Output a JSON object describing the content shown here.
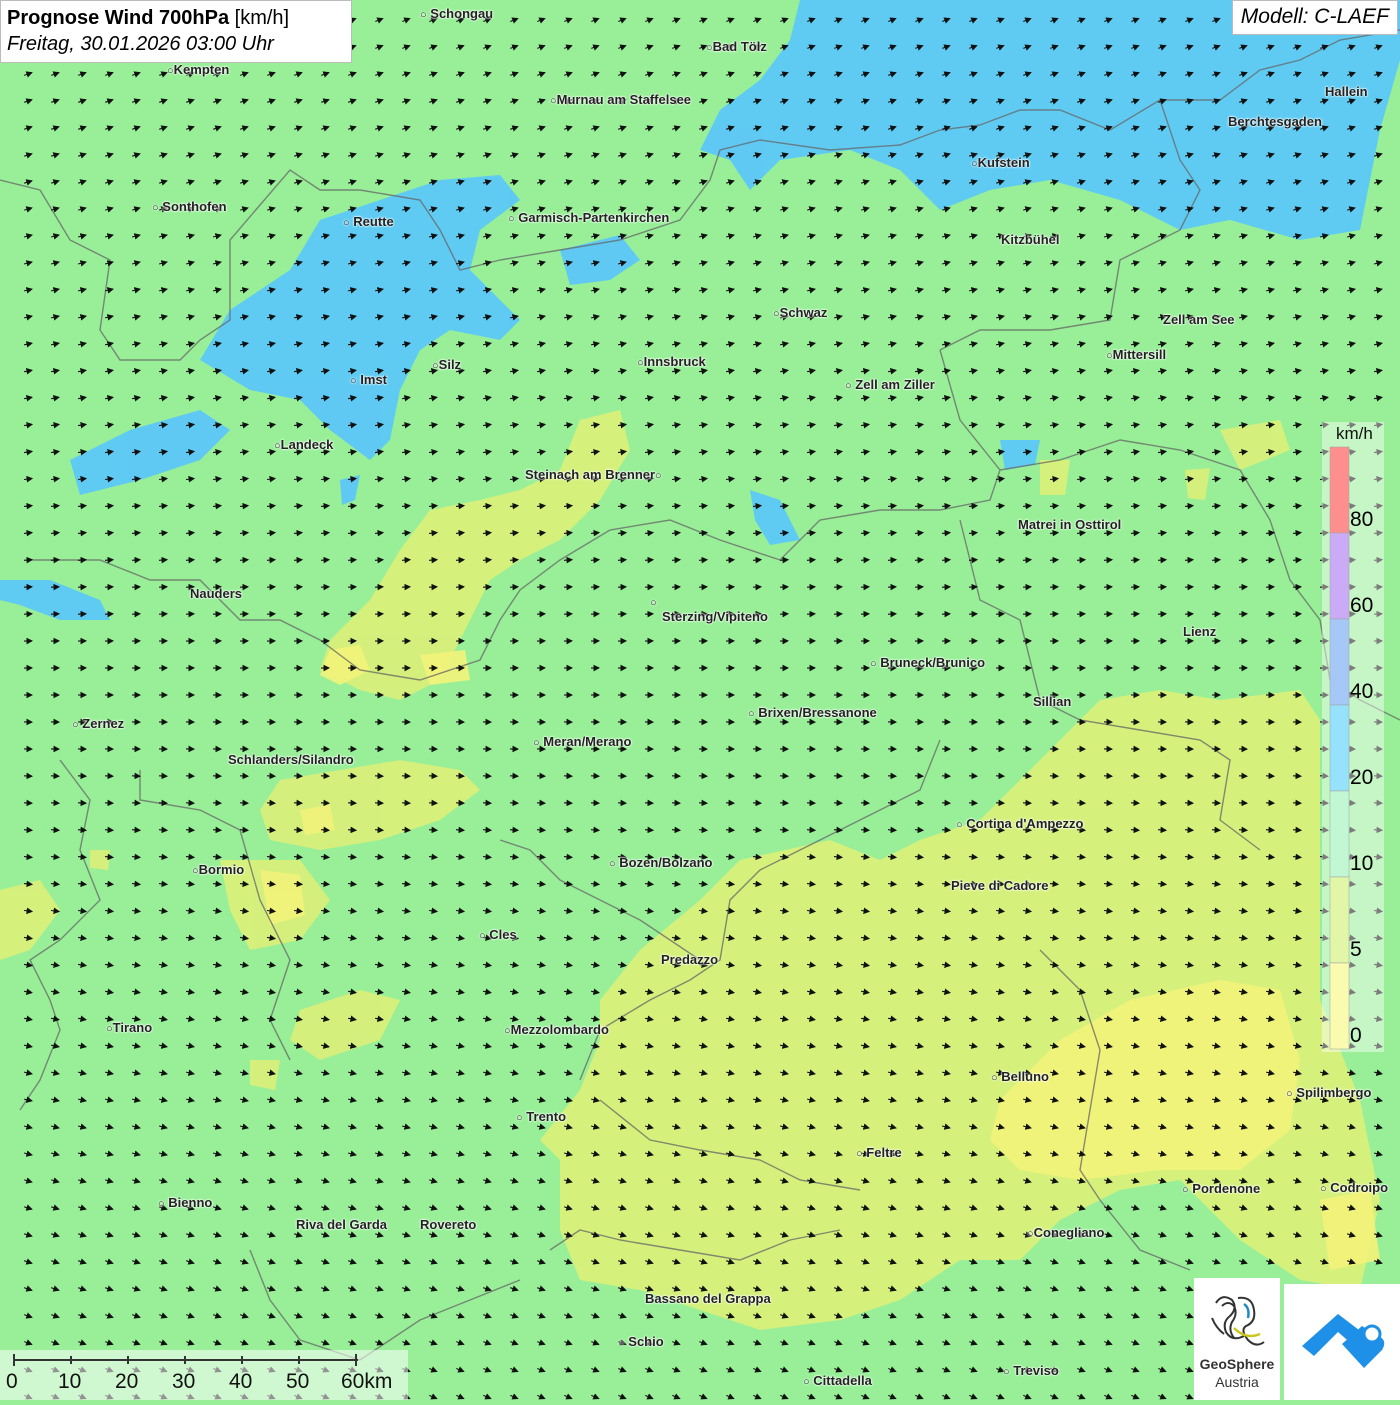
{
  "title": {
    "main": "Prognose Wind 700hPa",
    "unit": "[km/h]",
    "datetime": "Freitag, 30.01.2026 03:00 Uhr"
  },
  "model": "Modell: C-LAEF",
  "legend": {
    "unit": "km/h",
    "ticks": [
      "80",
      "60",
      "40",
      "20",
      "10",
      "5",
      "0"
    ],
    "colors": [
      "#ff3333",
      "#a066ee",
      "#5b9bf0",
      "#40c8f8",
      "#8ef0b0",
      "#c8f060",
      "#f8f870"
    ]
  },
  "colors": {
    "background": "#98ef98",
    "wind_10_20": "#5cc8f8",
    "wind_5_10": "#d8f07a",
    "arrow": "#111111"
  },
  "cities": [
    {
      "name": "Schongau"
    },
    {
      "name": "Bad Tölz"
    },
    {
      "name": "Kempten"
    },
    {
      "name": "Murnau am Staffelsee"
    },
    {
      "name": "Hallein"
    },
    {
      "name": "Berchtesgaden"
    },
    {
      "name": "Kufstein"
    },
    {
      "name": "Sonthofen"
    },
    {
      "name": "Reutte"
    },
    {
      "name": "Garmisch-Partenkirchen"
    },
    {
      "name": "Kitzbühel"
    },
    {
      "name": "Schwaz"
    },
    {
      "name": "Zell am See"
    },
    {
      "name": "Mittersill"
    },
    {
      "name": "Innsbruck"
    },
    {
      "name": "Imst"
    },
    {
      "name": "Silz"
    },
    {
      "name": "Zell am Ziller"
    },
    {
      "name": "Landeck"
    },
    {
      "name": "Steinach am Brenner"
    },
    {
      "name": "Matrei in Osttirol"
    },
    {
      "name": "Nauders"
    },
    {
      "name": "Sterzing/Vipiteno"
    },
    {
      "name": "Lienz"
    },
    {
      "name": "Bruneck/Brunico"
    },
    {
      "name": "Sillian"
    },
    {
      "name": "Zernez"
    },
    {
      "name": "Brixen/Bressanone"
    },
    {
      "name": "Meran/Merano"
    },
    {
      "name": "Schlanders/Silandro"
    },
    {
      "name": "Cortina d'Ampezzo"
    },
    {
      "name": "Bozen/Bolzano"
    },
    {
      "name": "Bormio"
    },
    {
      "name": "Pieve di Cadore"
    },
    {
      "name": "Cles"
    },
    {
      "name": "Predazzo"
    },
    {
      "name": "Tirano"
    },
    {
      "name": "Mezzolombardo"
    },
    {
      "name": "Belluno"
    },
    {
      "name": "Spilimbergo"
    },
    {
      "name": "Trento"
    },
    {
      "name": "Feltre"
    },
    {
      "name": "Pordenone"
    },
    {
      "name": "Codroipo"
    },
    {
      "name": "Bienno"
    },
    {
      "name": "Riva del Garda"
    },
    {
      "name": "Rovereto"
    },
    {
      "name": "Conegliano"
    },
    {
      "name": "Bassano del Grappa"
    },
    {
      "name": "Schio"
    },
    {
      "name": "Treviso"
    },
    {
      "name": "Cittadella"
    }
  ],
  "scale_bar": {
    "labels": [
      "0",
      "10",
      "20",
      "30",
      "40",
      "50",
      "60km"
    ]
  },
  "logo": {
    "line1": "GeoSphere",
    "line2": "Austria"
  }
}
